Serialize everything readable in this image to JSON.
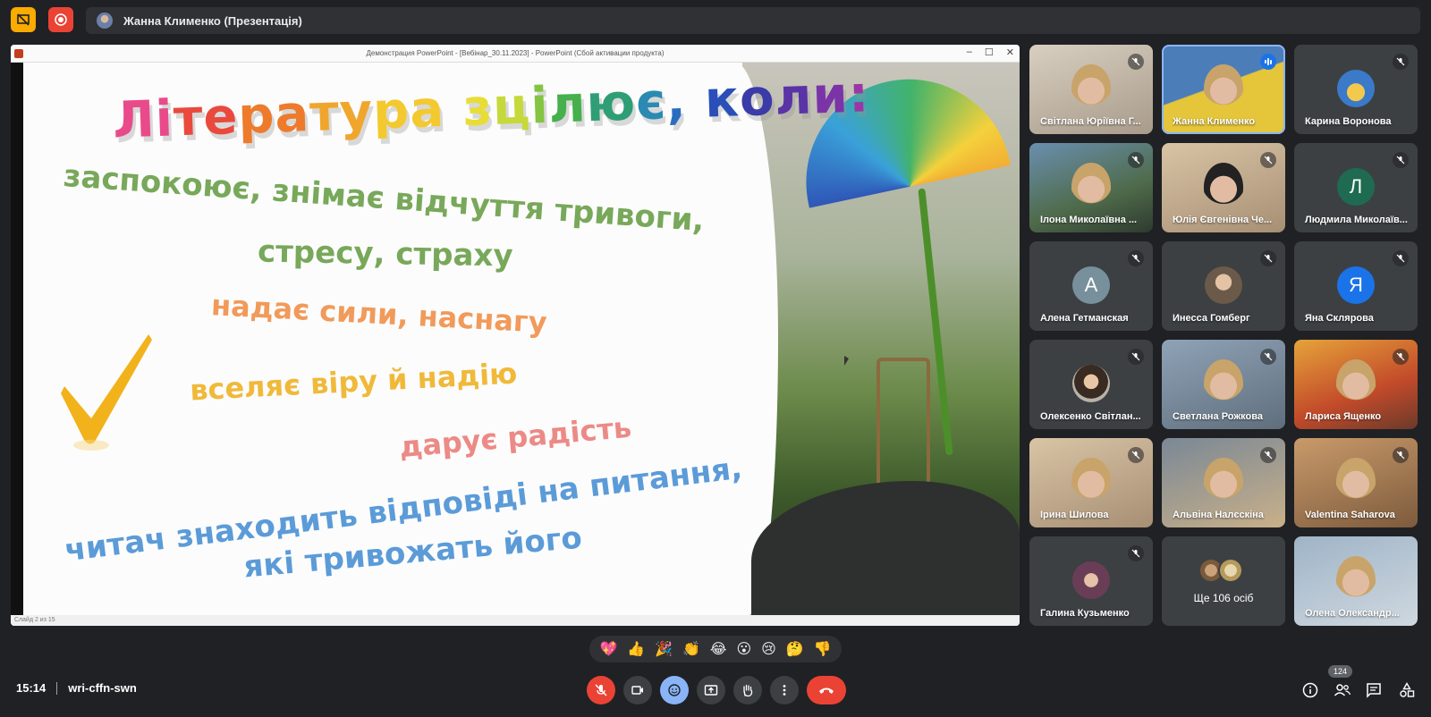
{
  "top_bar": {
    "presenter_label": "Жанна Клименко (Презентація)"
  },
  "presentation": {
    "window_title": "Демонстрация PowerPoint - [Вебінар_30.11.2023] - PowerPoint (Сбой активации продукта)",
    "status_text": "Слайд 2 из 15",
    "slide": {
      "title_letters": [
        {
          "ch": "Л",
          "color": "#e94b8a"
        },
        {
          "ch": "і",
          "color": "#e94b8a"
        },
        {
          "ch": "т",
          "color": "#e94a3d"
        },
        {
          "ch": "е",
          "color": "#e94a3d"
        },
        {
          "ch": "р",
          "color": "#ee7b2b"
        },
        {
          "ch": "а",
          "color": "#ee7b2b"
        },
        {
          "ch": "т",
          "color": "#f0a62c"
        },
        {
          "ch": "у",
          "color": "#f0a62c"
        },
        {
          "ch": "р",
          "color": "#f3c92f"
        },
        {
          "ch": "а",
          "color": "#f3c92f"
        },
        {
          "ch": " ",
          "color": "#000000"
        },
        {
          "ch": "з",
          "color": "#e8dd34"
        },
        {
          "ch": "ц",
          "color": "#c6d93a"
        },
        {
          "ch": "і",
          "color": "#84c442"
        },
        {
          "ch": "л",
          "color": "#45b04c"
        },
        {
          "ch": "ю",
          "color": "#2f9e74"
        },
        {
          "ch": "є",
          "color": "#2a8ab2"
        },
        {
          "ch": ",",
          "color": "#2a6dc0"
        },
        {
          "ch": " ",
          "color": "#000000"
        },
        {
          "ch": "к",
          "color": "#2a4fb8"
        },
        {
          "ch": "о",
          "color": "#3a3aa8"
        },
        {
          "ch": "л",
          "color": "#5a33a6"
        },
        {
          "ch": "и",
          "color": "#7a34a8"
        },
        {
          "ch": ":",
          "color": "#9a37a4"
        }
      ],
      "line1": "заспокоює, знімає відчуття тривоги,",
      "line2": "стресу, страху",
      "line3": "надає сили, наснагу",
      "line4": "вселяє віру й надію",
      "line5": "дарує радість",
      "line6": "читач знаходить відповіді на питання,",
      "line7": "які тривожать його"
    }
  },
  "participants": [
    {
      "name": "Світлана Юріївна Г...",
      "muted": true
    },
    {
      "name": "Жанна Клименко",
      "muted": false,
      "speaking": true
    },
    {
      "name": "Карина Воронова",
      "muted": true
    },
    {
      "name": "Ілона Миколаївна ...",
      "muted": true
    },
    {
      "name": "Юлія Євгенівна Че...",
      "muted": true
    },
    {
      "name": "Людмила Миколаїв...",
      "muted": true,
      "letter": "Л"
    },
    {
      "name": "Алена Гетманская",
      "muted": true,
      "letter": "А"
    },
    {
      "name": "Инесса Гомберг",
      "muted": true
    },
    {
      "name": "Яна Склярова",
      "muted": true,
      "letter": "Я"
    },
    {
      "name": "Олексенко Світлан...",
      "muted": true
    },
    {
      "name": "Светлана Рожкова",
      "muted": true
    },
    {
      "name": "Лариса Ященко",
      "muted": true
    },
    {
      "name": "Ірина Шилова",
      "muted": true
    },
    {
      "name": "Альвіна Налєскіна",
      "muted": true
    },
    {
      "name": "Valentina Saharova",
      "muted": true
    },
    {
      "name": "Галина Кузьменко",
      "muted": true
    },
    {
      "name": "Ще 106 осіб",
      "muted": false
    },
    {
      "name": "Олена Олександр...",
      "muted": false
    }
  ],
  "reactions": [
    "💖",
    "👍",
    "🎉",
    "👏",
    "😂",
    "😮",
    "😢",
    "🤔",
    "👎"
  ],
  "bottom_bar": {
    "time": "15:14",
    "meeting_code": "wri-cffn-swn",
    "people_count": "124"
  },
  "colors": {
    "background": "#202124",
    "tile": "#3c4043",
    "danger": "#ea4335",
    "accent": "#8ab4f8",
    "warning": "#f9ab00"
  }
}
